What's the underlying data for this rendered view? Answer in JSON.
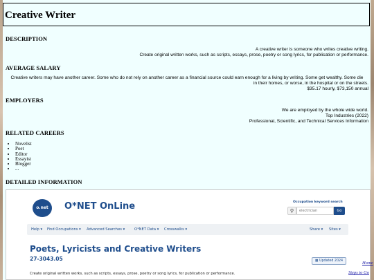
{
  "page": {
    "title": "Creative Writer"
  },
  "sections": {
    "description": {
      "heading": "DESCRIPTION",
      "lines": [
        "A creative writer is someone who writes creative writing.",
        "Create original written works, such as scripts, essays, prose, poetry or song lyrics, for publication or performance."
      ]
    },
    "salary": {
      "heading": "AVERAGE SALARY",
      "lines": [
        "Creative writers may have another career. Some who do not rely on another career as a financial source could earn enough for a living by writing. Some get wealthy. Some die",
        "in their homes, or worse, in the hospital or on the streets.",
        "$35.17 hourly, $73,150 annual"
      ]
    },
    "employers": {
      "heading": "EMPLOYERS",
      "lines": [
        "We are employed by the whole wide world.",
        "Top Industries (2022)",
        "Professional, Scientific, and Technical Services Information"
      ]
    },
    "related": {
      "heading": "RELATED CAREERS",
      "items": [
        "Novelist",
        "Poet",
        "Editor",
        "Essayist",
        "Blogger",
        "..."
      ]
    },
    "detailed": {
      "heading": "DETAILED INFORMATION"
    }
  },
  "onet": {
    "logo_badge": "o.net",
    "logo_text": "O*NET OnLine",
    "keyword_label": "Occupation keyword search",
    "search_placeholder": "electrician",
    "go_label": "Go",
    "nav": {
      "help": "Help ▾",
      "find": "Find Occupations ▾",
      "advanced": "Advanced Searches ▾",
      "data": "O*NET Data ▾",
      "crosswalks": "Crosswalks ▾",
      "share": "Share ▾",
      "sites": "Sites ▾"
    },
    "occupation_title": "Poets, Lyricists and Creative Writers",
    "occupation_code": "27-3043.05",
    "updated": "Updated 2024",
    "description": "Create original written works, such as scripts, essays, prose, poetry or song lyrics, for publication or performance."
  },
  "side_links": {
    "home": "Home",
    "steps": "Steps to Go"
  },
  "colors": {
    "page_bg": "#f0ffff",
    "onet_blue": "#1e4d8c",
    "link": "#1a1aa6"
  }
}
